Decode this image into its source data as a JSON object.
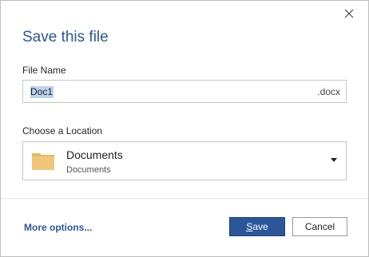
{
  "dialog": {
    "title": "Save this file",
    "close_icon": "close-icon"
  },
  "file_name": {
    "label": "File Name",
    "value": "Doc1",
    "extension": ".docx"
  },
  "location": {
    "label": "Choose a Location",
    "selected": "Documents",
    "path": "Documents",
    "icon": "folder-icon",
    "dropdown_icon": "chevron-down-icon"
  },
  "footer": {
    "more_options": "More options...",
    "save_first": "S",
    "save_rest": "ave",
    "cancel": "Cancel"
  },
  "colors": {
    "accent": "#2b579a",
    "folder": "#f0c67a",
    "selection": "#bcd4ee"
  }
}
